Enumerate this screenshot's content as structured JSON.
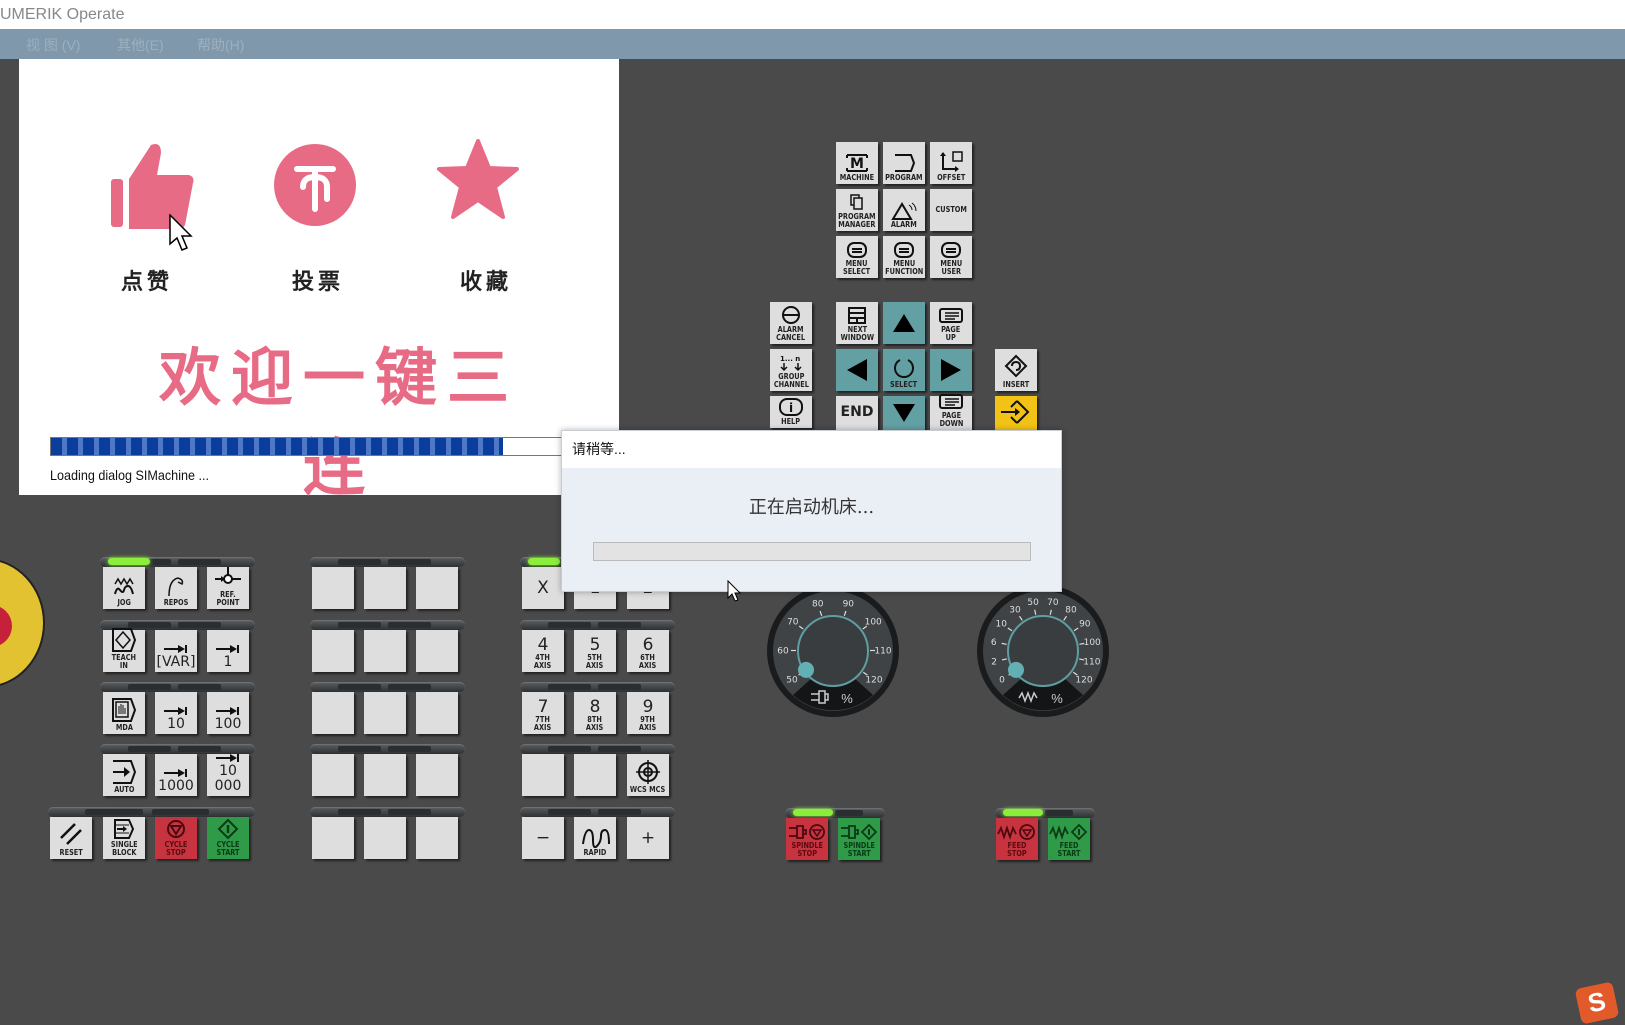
{
  "window": {
    "title": "UMERIK Operate"
  },
  "menu": [
    {
      "label": "视 图 (V)"
    },
    {
      "label": "其他(E)"
    },
    {
      "label": "帮助(H)"
    }
  ],
  "splash": {
    "actions": [
      {
        "icon": "thumbs-up-icon",
        "label": "点赞"
      },
      {
        "icon": "coin-icon",
        "label": "投票"
      },
      {
        "icon": "star-icon",
        "label": "收藏"
      }
    ],
    "slogan": "欢迎一键三连",
    "progress_fraction": 0.84,
    "loading_text": "Loading dialog SIMachine ..."
  },
  "dialog": {
    "title": "请稍等...",
    "message": "正在启动机床...",
    "progress_fraction": 0
  },
  "operator_keys": {
    "top": [
      {
        "label": "MACHINE",
        "icon": "machine-icon"
      },
      {
        "label": "PROGRAM",
        "icon": "program-icon"
      },
      {
        "label": "OFFSET",
        "icon": "offset-icon"
      },
      {
        "label": "PROGRAM MANAGER",
        "icon": "program-manager-icon"
      },
      {
        "label": "ALARM",
        "icon": "alarm-icon"
      },
      {
        "label": "CUSTOM",
        "icon": ""
      },
      {
        "label": "MENU SELECT",
        "icon": "menu-icon"
      },
      {
        "label": "MENU FUNCTION",
        "icon": "menu-icon"
      },
      {
        "label": "MENU USER",
        "icon": "menu-icon"
      }
    ],
    "left_column": [
      {
        "label": "ALARM CANCEL",
        "icon": "alarm-cancel-icon"
      },
      {
        "label": "GROUP CHANNEL",
        "icon": "group-channel-icon"
      },
      {
        "label": "HELP",
        "icon": "info-icon"
      }
    ],
    "nav": {
      "next_window": "NEXT WINDOW",
      "page_up": "PAGE UP",
      "select": "SELECT",
      "end": "END",
      "page_down": "PAGE DOWN"
    },
    "insert": "INSERT",
    "input": "INPUT"
  },
  "mode_keys": [
    {
      "label": "JOG",
      "icon": "jog-icon"
    },
    {
      "label": "REPOS",
      "icon": "repos-icon"
    },
    {
      "label": "REF. POINT",
      "icon": "ref-point-icon"
    },
    {
      "label": "TEACH IN",
      "icon": "teach-in-icon"
    },
    {
      "label": "[VAR]",
      "icon": "increment-icon"
    },
    {
      "label": "1",
      "icon": "increment-icon"
    },
    {
      "label": "MDA",
      "icon": "mda-icon"
    },
    {
      "label": "10",
      "icon": "increment-icon"
    },
    {
      "label": "100",
      "icon": "increment-icon"
    },
    {
      "label": "AUTO",
      "icon": "auto-icon"
    },
    {
      "label": "1000",
      "icon": "increment-icon"
    },
    {
      "label": "10 000",
      "icon": "increment-icon"
    }
  ],
  "bottom_keys": [
    {
      "label": "RESET",
      "icon": "reset-icon"
    },
    {
      "label": "SINGLE BLOCK",
      "icon": "single-block-icon"
    },
    {
      "label": "CYCLE STOP",
      "icon": "stop-icon"
    },
    {
      "label": "CYCLE START",
      "icon": "start-icon"
    }
  ],
  "axis_keys": [
    {
      "num": "X",
      "label": ""
    },
    {
      "num": "1",
      "label": ""
    },
    {
      "num": "2",
      "label": ""
    },
    {
      "num": "4",
      "label": "4TH AXIS"
    },
    {
      "num": "5",
      "label": "5TH AXIS"
    },
    {
      "num": "6",
      "label": "6TH AXIS"
    },
    {
      "num": "7",
      "label": "7TH AXIS"
    },
    {
      "num": "8",
      "label": "8TH AXIS"
    },
    {
      "num": "9",
      "label": "9TH AXIS"
    },
    {
      "num": "",
      "label": ""
    },
    {
      "num": "",
      "label": ""
    },
    {
      "num": "",
      "label": "WCS MCS"
    },
    {
      "num": "−",
      "label": ""
    },
    {
      "num": "",
      "label": "RAPID"
    },
    {
      "num": "+",
      "label": ""
    }
  ],
  "dials": [
    {
      "name": "spindle-override",
      "ticks": [
        "50",
        "60",
        "70",
        "80",
        "90",
        "100",
        "110",
        "120"
      ],
      "unit": "%",
      "value": 50
    },
    {
      "name": "feed-override",
      "ticks": [
        "0",
        "2",
        "6",
        "10",
        "30",
        "50",
        "70",
        "80",
        "90",
        "100",
        "110",
        "120"
      ],
      "unit": "%",
      "value": 0
    }
  ],
  "spindle_keys": [
    {
      "label": "SPINDLE STOP"
    },
    {
      "label": "SPINDLE START"
    }
  ],
  "feed_keys": [
    {
      "label": "FEED STOP"
    },
    {
      "label": "FEED START"
    }
  ],
  "colors": {
    "panel_bg": "#4a4a4a",
    "key_bg": "#dedede",
    "teal": "#63a0a4",
    "stop_red": "#c7333f",
    "start_green": "#2f9a48",
    "led_green": "#8aee3a",
    "splash_pink": "#e86b86"
  }
}
